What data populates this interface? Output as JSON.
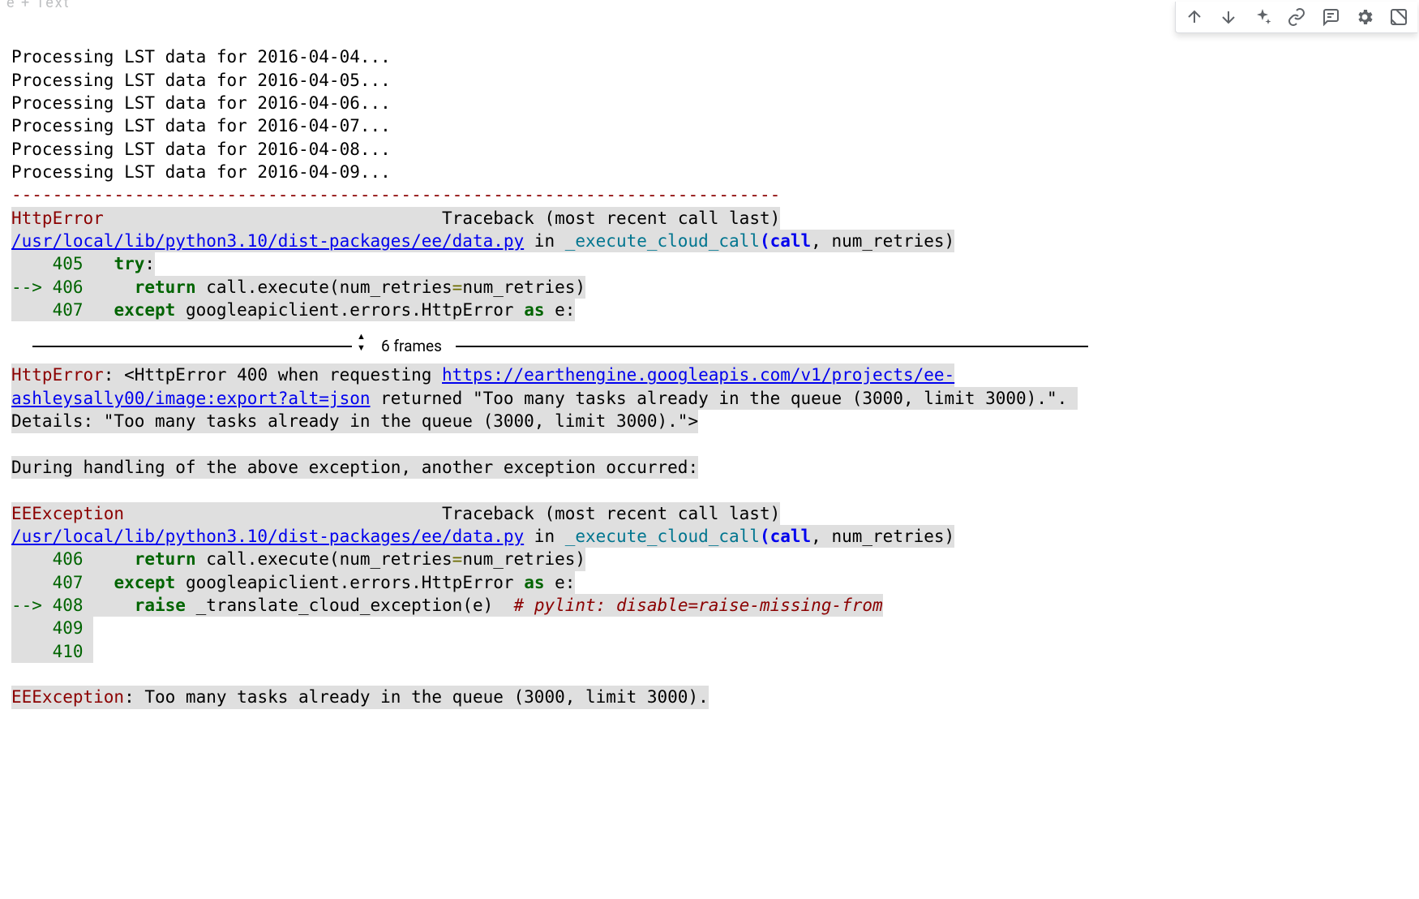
{
  "toolbar": {
    "faint_hint": "e   + Text"
  },
  "cell_actions": {
    "items": [
      {
        "name": "move-up-icon"
      },
      {
        "name": "move-down-icon"
      },
      {
        "name": "sparkle-icon"
      },
      {
        "name": "link-icon"
      },
      {
        "name": "comment-icon"
      },
      {
        "name": "gear-icon"
      },
      {
        "name": "mirror-cell-icon"
      }
    ]
  },
  "output": {
    "stdout": [
      "Processing LST data for 2016-04-04...",
      "Processing LST data for 2016-04-05...",
      "Processing LST data for 2016-04-06...",
      "Processing LST data for 2016-04-07...",
      "Processing LST data for 2016-04-08...",
      "Processing LST data for 2016-04-09..."
    ],
    "hr_dashes": "---------------------------------------------------------------------------",
    "tb1": {
      "error_name": "HttpError",
      "header_right": "Traceback (most recent call last)",
      "file_path": "/usr/local/lib/python3.10/dist-packages/ee/data.py",
      "in_word": " in ",
      "func": "_execute_cloud_call",
      "sig_open": "(call",
      "sig_rest": ", num_retries)",
      "lines": [
        {
          "marker": "    ",
          "no": "405",
          "prefix": "   ",
          "code_a": "try",
          "code_b": ":"
        },
        {
          "marker": "--> ",
          "no": "406",
          "prefix": "     ",
          "code_a": "return",
          "code_b": " call.execute(num_retries",
          "code_c": "=",
          "code_d": "num_retries)"
        },
        {
          "marker": "    ",
          "no": "407",
          "prefix": "   ",
          "code_a": "except",
          "code_b": " googleapiclient.errors.HttpError ",
          "code_c": "as",
          "code_d": " e:"
        }
      ]
    },
    "frames_label": "6 frames",
    "http_error_block": {
      "name": "HttpError",
      "colon": ": ",
      "pre_link": "<HttpError 400 when requesting ",
      "link": "https://earthengine.googleapis.com/v1/projects/ee-ashleysally00/image:export?alt=json",
      "post_link": " returned \"Too many tasks already in the queue (3000, limit 3000).\". Details: \"Too many tasks already in the queue (3000, limit 3000).\">"
    },
    "during_msg": "During handling of the above exception, another exception occurred:",
    "tb2": {
      "error_name": "EEException",
      "header_right": "Traceback (most recent call last)",
      "file_path": "/usr/local/lib/python3.10/dist-packages/ee/data.py",
      "in_word": " in ",
      "func": "_execute_cloud_call",
      "sig_open": "(call",
      "sig_rest": ", num_retries)",
      "lines": [
        {
          "marker": "    ",
          "no": "406",
          "prefix": "     ",
          "code_a": "return",
          "code_b": " call.execute(num_retries",
          "code_c": "=",
          "code_d": "num_retries)"
        },
        {
          "marker": "    ",
          "no": "407",
          "prefix": "   ",
          "code_a": "except",
          "code_b": " googleapiclient.errors.HttpError ",
          "code_c": "as",
          "code_d": " e:"
        },
        {
          "marker": "--> ",
          "no": "408",
          "prefix": "     ",
          "code_a": "raise",
          "code_b": " _translate_cloud_exception(e)  ",
          "code_comment": "# pylint: disable=raise-missing-from"
        },
        {
          "marker": "    ",
          "no": "409",
          "prefix": "",
          "code_b": ""
        },
        {
          "marker": "    ",
          "no": "410",
          "prefix": "",
          "code_b": ""
        }
      ]
    },
    "final_error": {
      "name": "EEException",
      "rest": ": Too many tasks already in the queue (3000, limit 3000)."
    }
  }
}
